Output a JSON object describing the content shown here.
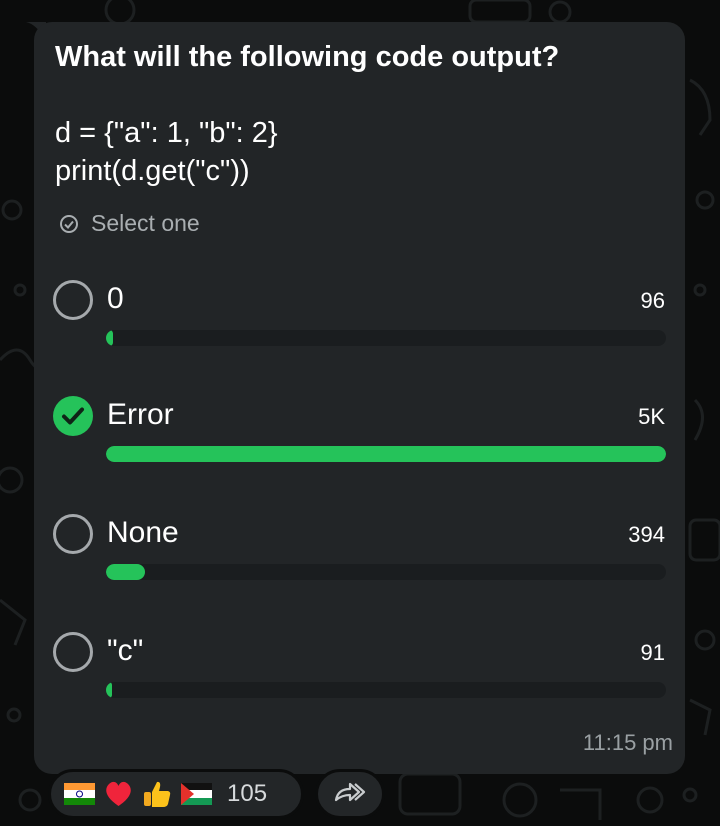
{
  "poll": {
    "title": "What will the following code output?",
    "code_lines": [
      "d = {\"a\": 1, \"b\": 2}",
      "print(d.get(\"c\"))"
    ],
    "select_hint": "Select one",
    "options": [
      {
        "label": "0",
        "count": "96",
        "fraction": 0.012,
        "selected": false
      },
      {
        "label": "Error",
        "count": "5K",
        "fraction": 1.0,
        "selected": true
      },
      {
        "label": "None",
        "count": "394",
        "fraction": 0.07,
        "selected": false
      },
      {
        "label": "\"c\"",
        "count": "91",
        "fraction": 0.011,
        "selected": false
      }
    ],
    "timestamp": "11:15 pm"
  },
  "reactions": {
    "items": [
      "flag-india-icon",
      "red-heart-icon",
      "thumbs-up-icon",
      "flag-palestine-icon"
    ],
    "count": "105"
  },
  "colors": {
    "accent": "#25c35a",
    "bubble": "#222527",
    "background": "#0b0c0c"
  }
}
